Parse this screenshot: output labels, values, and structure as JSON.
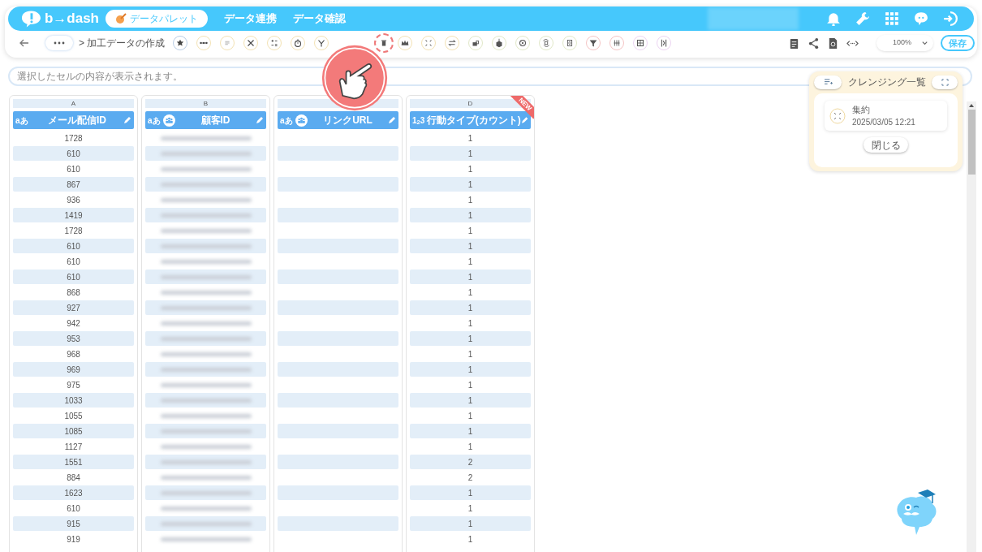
{
  "header": {
    "logo": "b→dash",
    "nav": [
      {
        "label": "データパレット",
        "selected": true
      },
      {
        "label": "データ連携",
        "selected": false
      },
      {
        "label": "データ確認",
        "selected": false
      }
    ]
  },
  "toolbar": {
    "breadcrumb": "> 加工データの作成",
    "zoom": "100%",
    "save": "保存"
  },
  "cell_viewer": {
    "placeholder": "選択したセルの内容が表示されます。"
  },
  "columns": [
    {
      "letter": "A",
      "type": "aあ",
      "title": "メール配信ID",
      "kind": "values",
      "linked": false,
      "new": false,
      "cells": [
        "1728",
        "610",
        "610",
        "867",
        "936",
        "1419",
        "1728",
        "610",
        "610",
        "610",
        "868",
        "927",
        "942",
        "953",
        "968",
        "969",
        "975",
        "1033",
        "1055",
        "1085",
        "1127",
        "1551",
        "884",
        "1623",
        "610",
        "915",
        "919"
      ]
    },
    {
      "letter": "B",
      "type": "aあ",
      "title": "顧客ID",
      "kind": "masked",
      "linked": true,
      "new": false
    },
    {
      "type": "aあ",
      "title": "リンクURL",
      "kind": "empty",
      "linked": true,
      "new": false
    },
    {
      "letter": "D",
      "type": "1$_{2}$3",
      "title": "行動タイプ(カウント)",
      "kind": "values",
      "linked": false,
      "new": true,
      "badge": "NEW",
      "cells": [
        "1",
        "1",
        "1",
        "1",
        "1",
        "1",
        "1",
        "1",
        "1",
        "1",
        "1",
        "1",
        "1",
        "1",
        "1",
        "1",
        "1",
        "1",
        "1",
        "1",
        "1",
        "2",
        "2",
        "1",
        "1",
        "1",
        "1"
      ]
    }
  ],
  "cleansing_panel": {
    "title": "クレンジング一覧",
    "items": [
      {
        "name": "集約",
        "time": "2025/03/05 12:21"
      }
    ],
    "close": "閉じる"
  }
}
